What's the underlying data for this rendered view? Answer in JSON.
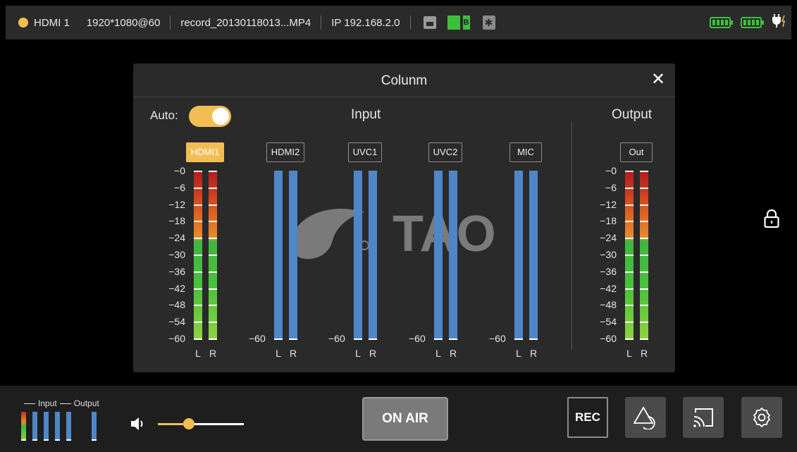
{
  "topbar": {
    "source": "HDMI 1",
    "resolution": "1920*1080@60",
    "filename": "record_20130118013...MP4",
    "ip": "IP 192.168.2.0",
    "sd_badge": "B",
    "icons": [
      "ethernet-icon",
      "sd-card-icon",
      "bluetooth-icon",
      "battery-icon",
      "battery-icon",
      "power-plug-icon"
    ],
    "status_dot_color": "#f2be54"
  },
  "panel": {
    "title": "Colunm",
    "auto_label": "Auto:",
    "auto_on": true,
    "input_heading": "Input",
    "output_heading": "Output",
    "watermark_text": "TAO",
    "inputs": [
      {
        "label": "HDMI1",
        "active": true,
        "type": "level"
      },
      {
        "label": "HDMI2",
        "active": false,
        "type": "blue"
      },
      {
        "label": "UVC1",
        "active": false,
        "type": "blue"
      },
      {
        "label": "UVC2",
        "active": false,
        "type": "blue"
      },
      {
        "label": "MIC",
        "active": false,
        "type": "blue"
      }
    ],
    "output": {
      "label": "Out",
      "type": "level"
    },
    "scale": [
      "−0",
      "−6",
      "−12",
      "−18",
      "−24",
      "−30",
      "−36",
      "−42",
      "−48",
      "−54",
      "−60"
    ],
    "scale_min": "−60",
    "left_channel": "L",
    "right_channel": "R"
  },
  "bottombar": {
    "mini_input_label": "Input",
    "mini_output_label": "Output",
    "volume_level": 0.36,
    "on_air_label": "ON AIR",
    "rec_label": "REC"
  },
  "colors": {
    "accent": "#f2be54",
    "meter_blue": "#4f87c6",
    "panel_bg": "#2a2a2b"
  }
}
